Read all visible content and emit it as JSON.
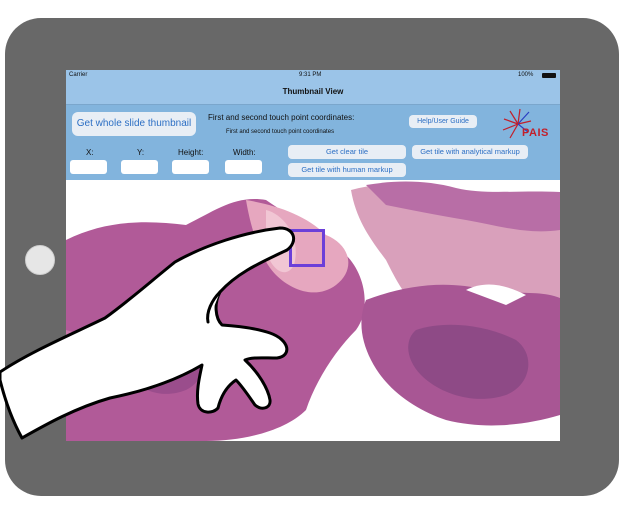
{
  "device": {
    "name": "iPad"
  },
  "status_bar": {
    "carrier": "Carrier",
    "time": "9:31 PM",
    "battery": "100%"
  },
  "nav": {
    "title": "Thumbnail View"
  },
  "toolbar": {
    "whole_slide_button": "Get whole slide thumbnail",
    "coords_title": "First and second touch point coordinates:",
    "coords_subtitle": "First and second touch point coordinates",
    "help_button": "Help/User Guide",
    "fields": {
      "x": "X:",
      "y": "Y:",
      "height": "Height:",
      "width": "Width:"
    },
    "clear_tile_button": "Get clear tile",
    "analytical_button": "Get tile with analytical markup",
    "human_button": "Get tile with human markup"
  },
  "logo": {
    "text": "PAIS"
  },
  "colors": {
    "toolbar": "#82b4dd",
    "nav": "#9bc4e8",
    "button_text": "#2c6fc4",
    "selection": "#6b3fd9",
    "tissue": "#b05a96"
  }
}
